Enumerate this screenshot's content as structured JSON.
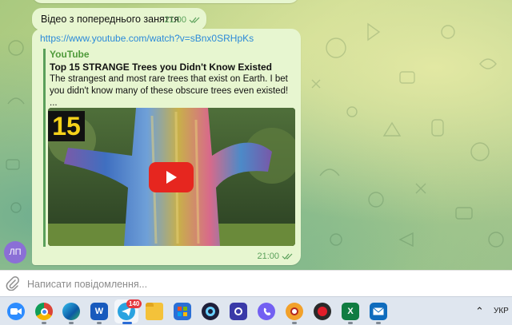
{
  "chat": {
    "top_time": "",
    "messages": [
      {
        "text": "Відео з попереднього заняття",
        "time": "21:00"
      },
      {
        "link": "https://www.youtube.com/watch?v=sBnx0SRHpKs",
        "preview": {
          "site": "YouTube",
          "title": "Top 15 STRANGE Trees you Didn't Know Existed",
          "description": "The strangest and most rare trees that exist on Earth. I bet you didn't know many of these obscure trees even existed!",
          "ellipsis": "...",
          "thumb_badge": "15"
        },
        "time": "21:00"
      }
    ],
    "avatar_initials": "ЛП"
  },
  "composer": {
    "placeholder": "Написати повідомлення..."
  },
  "taskbar": {
    "telegram_badge": "140",
    "language": "УКР",
    "apps": [
      "zoom",
      "chrome",
      "edge",
      "word",
      "telegram",
      "file-explorer",
      "microsoft-store",
      "app-dark",
      "app-blue",
      "viber",
      "app-crosshair",
      "app-red",
      "excel",
      "mail"
    ]
  },
  "colors": {
    "bubble": "#e7f6d0",
    "link": "#2b8ad9",
    "accent": "#5aa05a",
    "avatar": "#8b6fd6"
  }
}
